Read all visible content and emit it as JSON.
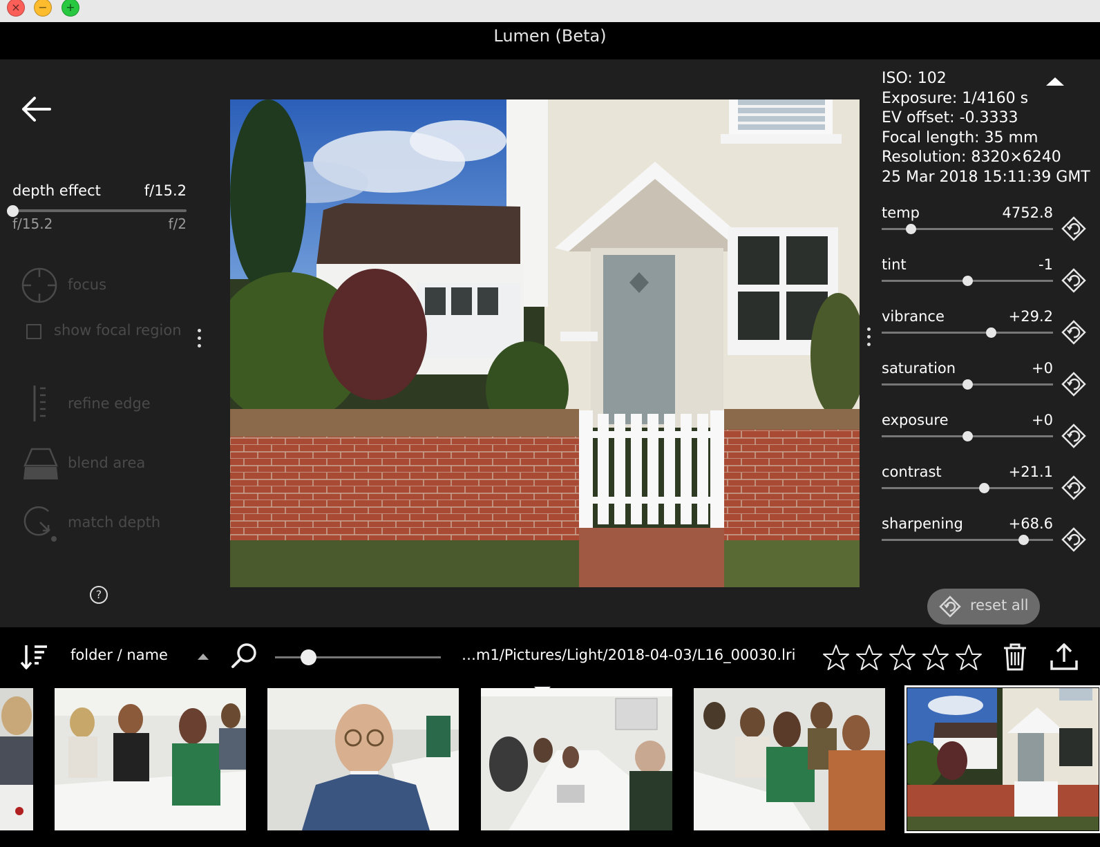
{
  "window": {
    "title": "Lumen (Beta)"
  },
  "left_panel": {
    "depth": {
      "label": "depth effect",
      "value": "f/15.2",
      "min_label": "f/15.2",
      "max_label": "f/2",
      "position": 0.0
    },
    "tools": [
      {
        "label": "focus",
        "icon": "focus-reticle-icon"
      },
      {
        "label": "show focal region",
        "icon": "checkbox-icon"
      },
      {
        "label": "refine edge",
        "icon": "refine-edge-icon"
      },
      {
        "label": "blend area",
        "icon": "blend-area-icon"
      },
      {
        "label": "match depth",
        "icon": "match-depth-icon"
      }
    ],
    "help_label": "?"
  },
  "metadata": {
    "iso": "ISO: 102",
    "exposure": "Exposure: 1/4160 s",
    "ev_offset": "EV offset: -0.3333",
    "focal_length": "Focal length: 35 mm",
    "resolution": "Resolution: 8320×6240",
    "timestamp": "25 Mar 2018 15:11:39 GMT"
  },
  "adjustments": [
    {
      "id": "temp",
      "label": "temp",
      "value": "4752.8",
      "position": 0.17
    },
    {
      "id": "tint",
      "label": "tint",
      "value": "-1",
      "position": 0.5
    },
    {
      "id": "vibrance",
      "label": "vibrance",
      "value": "+29.2",
      "position": 0.64
    },
    {
      "id": "saturation",
      "label": "saturation",
      "value": "+0",
      "position": 0.5
    },
    {
      "id": "exposure",
      "label": "exposure",
      "value": "+0",
      "position": 0.5
    },
    {
      "id": "contrast",
      "label": "contrast",
      "value": "+21.1",
      "position": 0.6
    },
    {
      "id": "sharpening",
      "label": "sharpening",
      "value": "+68.6",
      "position": 0.83
    }
  ],
  "reset_all_label": "reset all",
  "toolbar": {
    "sort_label": "folder / name",
    "zoom_position": 0.2,
    "file_path": "…m1/Pictures/Light/2018-04-03/L16_00030.lri",
    "rating": 0,
    "rating_max": 5
  },
  "colors": {
    "panel_bg": "#1f1f1f",
    "disabled_text": "#4a4a4a",
    "reset_pill": "#6b6b6b"
  },
  "filmstrip": {
    "thumbnails": [
      {
        "id": "partial-meeting",
        "selected": false
      },
      {
        "id": "women-at-table",
        "selected": false
      },
      {
        "id": "man-with-glasses",
        "selected": false
      },
      {
        "id": "conference-room",
        "selected": false
      },
      {
        "id": "meeting-attendees",
        "selected": false
      },
      {
        "id": "cottage",
        "selected": true
      }
    ]
  }
}
